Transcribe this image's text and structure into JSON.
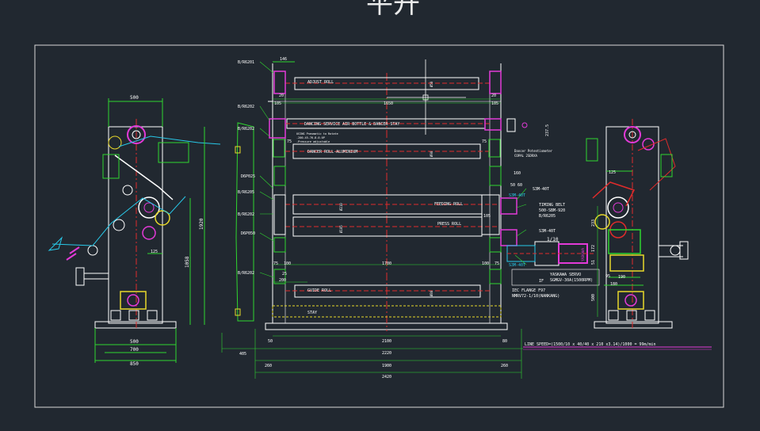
{
  "colors": {
    "background": "#212830",
    "frame": "#d9d9d9",
    "outline": "#ffffff",
    "dimension": "#2fd62f",
    "centerline": "#e02b2b",
    "cyan": "#28c8e8",
    "magenta": "#e33ad8",
    "yellow": "#e8d82a"
  },
  "header_glyphs": "平开",
  "roll_labels": {
    "adjust": "ADJUST ROLL",
    "dancing": "DANCING SERVICE AIR BOTTLE & DANCER STAY",
    "dancer": "DANCER ROLL-ALUMINIUM",
    "feeding": "FEEDING ROLL",
    "press": "PRESS ROLL",
    "guide": "GUIDE ROLL",
    "stay": "STAY"
  },
  "bearing_labels": {
    "b1": "B/R6201",
    "b2": "B/R6202",
    "b3": "B/R6202",
    "b4": "B/R6205",
    "b5": "B/R6202",
    "d1": "D6P025",
    "d2": "D6P050"
  },
  "top_notes": {
    "n1": "USING Pneumatic to Rotate",
    "n2": "-200-45-76-8-0-0P",
    "n3": "-Pressure adjustable"
  },
  "side_notes": {
    "potentiometer_1": "Dancer Potentiometer",
    "potentiometer_2": "COPAL 2SDRXA",
    "timing_belt_1": "TIMING BELT",
    "timing_belt_2": "500-SBM-920",
    "timing_belt_3": "B/R6205",
    "pulley_1": "S3M-40T",
    "pulley_2": "S3M-40T",
    "pulley_3": "S3M-40T",
    "pulley_4": "S3M-40T",
    "ratio": "1/10",
    "servo_1": "YASKAWA SERVO",
    "servo_2": "SGMGV-30A(1500RPM)",
    "flange_1": "IEC FLANGE F97",
    "flange_2": "NMRV72-1/10(NANKANG)",
    "if_mark": "IF",
    "line_speed": "LINE SPEED=(1500/10 x 40/40 x 210 x3.14)/1000 = 99m/min"
  },
  "dimensions": {
    "d146": "146",
    "d105a": "105",
    "d105b": "105",
    "d20a": "20",
    "d20b": "20",
    "d1650": "1650",
    "d75a": "75",
    "d75b": "75",
    "d160": "160",
    "d5060": "50 60",
    "d105c": "105",
    "d75c": "75",
    "d100a": "100",
    "d1700": "1700",
    "d100b": "100",
    "d75d": "75",
    "d25": "25",
    "d200": "200",
    "d50a": "50",
    "d2100": "2100",
    "d80": "80",
    "d405": "405",
    "d2220": "2220",
    "d260a": "260",
    "d1900": "1900",
    "d260b": "260",
    "d2420": "2420",
    "d500a": "500",
    "d125a": "125",
    "d1920": "1920",
    "d1058": "1058",
    "d500b": "500",
    "d700": "700",
    "d850": "850",
    "d2375": "237.5",
    "d125b": "125",
    "d233": "233",
    "d172": "172",
    "d51": "51",
    "d95": "95",
    "d190": "190",
    "d180": "180",
    "d500c": "500"
  },
  "roll_diameters": {
    "adjust": "Ø50",
    "dancer": "Ø90",
    "feeding": "Ø210",
    "press": "Ø105",
    "guide": "Ø80",
    "stay": "Ø50"
  },
  "motor_label": "YASKAWA"
}
